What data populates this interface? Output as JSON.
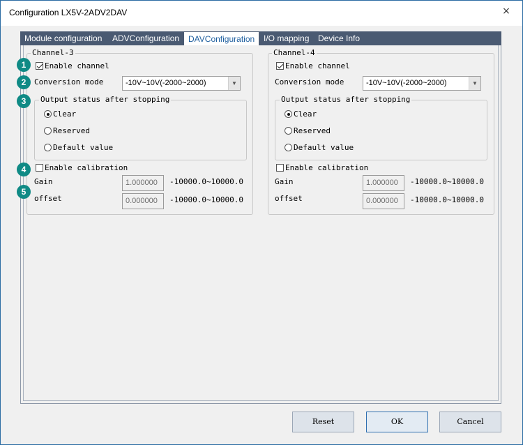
{
  "window": {
    "title": "Configuration LX5V-2ADV2DAV",
    "close_symbol": "×"
  },
  "tabs": [
    {
      "label": "Module configuration"
    },
    {
      "label": "ADVConfiguration"
    },
    {
      "label": "DAVConfiguration"
    },
    {
      "label": "I/O mapping"
    },
    {
      "label": "Device Info"
    }
  ],
  "active_tab": "DAVConfiguration",
  "channels": [
    {
      "title": "Channel-3",
      "enable_channel_label": "Enable channel",
      "enable_channel_checked": true,
      "conversion_mode_label": "Conversion mode",
      "conversion_mode_value": "-10V~10V(-2000~2000)",
      "output_status_title": "Output status after stopping",
      "output_options": [
        "Clear",
        "Reserved",
        "Default value"
      ],
      "output_selected": "Clear",
      "enable_calibration_label": "Enable calibration",
      "enable_calibration_checked": false,
      "gain_label": "Gain",
      "gain_value": "1.000000",
      "gain_range": "-10000.0~10000.0",
      "offset_label": "offset",
      "offset_value": "0.000000",
      "offset_range": "-10000.0~10000.0"
    },
    {
      "title": "Channel-4",
      "enable_channel_label": "Enable channel",
      "enable_channel_checked": true,
      "conversion_mode_label": "Conversion mode",
      "conversion_mode_value": "-10V~10V(-2000~2000)",
      "output_status_title": "Output status after stopping",
      "output_options": [
        "Clear",
        "Reserved",
        "Default value"
      ],
      "output_selected": "Clear",
      "enable_calibration_label": "Enable calibration",
      "enable_calibration_checked": false,
      "gain_label": "Gain",
      "gain_value": "1.000000",
      "gain_range": "-10000.0~10000.0",
      "offset_label": "offset",
      "offset_value": "0.000000",
      "offset_range": "-10000.0~10000.0"
    }
  ],
  "badges": [
    "1",
    "2",
    "3",
    "4",
    "5"
  ],
  "buttons": {
    "reset": "Reset",
    "ok": "OK",
    "cancel": "Cancel"
  },
  "colors": {
    "tab_bar": "#4a5a72",
    "active_tab_text": "#1f5f9f",
    "badge": "#0f8a85"
  }
}
